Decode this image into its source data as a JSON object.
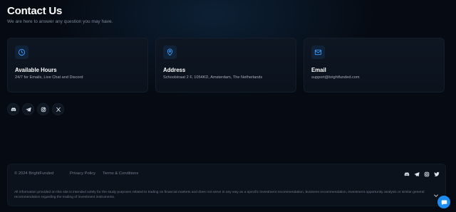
{
  "header": {
    "title": "Contact Us",
    "subtitle": "We are here to answer any question you may have."
  },
  "cards": [
    {
      "icon": "clock-icon",
      "title": "Available Hours",
      "text": "24/7 for Emails, Live Chat and Discord"
    },
    {
      "icon": "location-pin-icon",
      "title": "Address",
      "text": "Schoolstraat 2 F, 1054KD, Amsterdam, The Netherlands"
    },
    {
      "icon": "mail-icon",
      "title": "Email",
      "text": "support@brightfunded.com"
    }
  ],
  "socials": [
    "discord-icon",
    "telegram-icon",
    "instagram-icon",
    "x-icon"
  ],
  "footer": {
    "copyright": "© 2024 BrightFunded",
    "links": [
      "Privacy Policy",
      "Terms & Conditions"
    ],
    "socials": [
      "discord-icon",
      "telegram-icon",
      "instagram-icon",
      "twitter-icon"
    ],
    "disclaimer": "All information provided on this site is intended solely for the study purposes related to trading on financial markets and does not serve in any way as a specific investment recommendation, business recommendation, investment opportunity analysis or similar general recommendation regarding the trading of investment instruments."
  },
  "chat_widget": {
    "icon": "chat-icon"
  },
  "colors": {
    "accent": "#3aa0ff",
    "background": "#060b13",
    "card": "#0e1623",
    "chat": "#1d8cf0"
  }
}
